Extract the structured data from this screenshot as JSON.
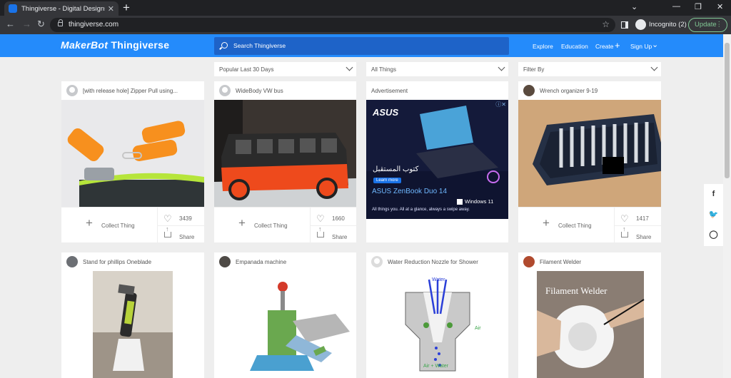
{
  "browser": {
    "tab_title": "Thingiverse - Digital Designs for",
    "url": "thingiverse.com",
    "incognito_label": "Incognito (2)",
    "update_label": "Update"
  },
  "header": {
    "logo_makerbot": "MakerBot",
    "logo_thingiverse": "Thingiverse",
    "search_placeholder": "Search Thingiverse",
    "nav": {
      "explore": "Explore",
      "education": "Education",
      "create": "Create",
      "signup": "Sign Up"
    }
  },
  "filters": {
    "sort": "Popular Last 30 Days",
    "category": "All Things",
    "filter_by": "Filter By"
  },
  "cards_row1": [
    {
      "title": "[with release hole] Zipper Pull using...",
      "likes": "3439",
      "collect": "Collect Thing",
      "share": "Share"
    },
    {
      "title": "WideBody VW bus",
      "likes": "1660",
      "collect": "Collect Thing",
      "share": "Share"
    },
    {
      "title": "Advertisement",
      "ad_brand": "ASUS",
      "ad_arabic": "كتوب المستقبل",
      "ad_learn": "Learn more",
      "ad_product": "ASUS ZenBook Duo 14",
      "ad_tagline": "All things you. All at a glance, always a swipe away.",
      "ad_windows": "Windows 11"
    },
    {
      "title": "Wrench organizer 9-19",
      "likes": "1417",
      "collect": "Collect Thing",
      "share": "Share"
    }
  ],
  "cards_row2": [
    {
      "title": "Stand for phillips Oneblade"
    },
    {
      "title": "Empanada machine"
    },
    {
      "title": "Water Reduction Nozzle for Shower",
      "img_label_water": "Water",
      "img_label_air_right": "Air",
      "img_label_air_left": "Air",
      "img_label_airwater": "Air + Water"
    },
    {
      "title": "Filament Welder",
      "img_label": "Filament Welder"
    }
  ],
  "colors": {
    "brand_blue": "#248bfb",
    "search_blue": "#1e63c8"
  }
}
